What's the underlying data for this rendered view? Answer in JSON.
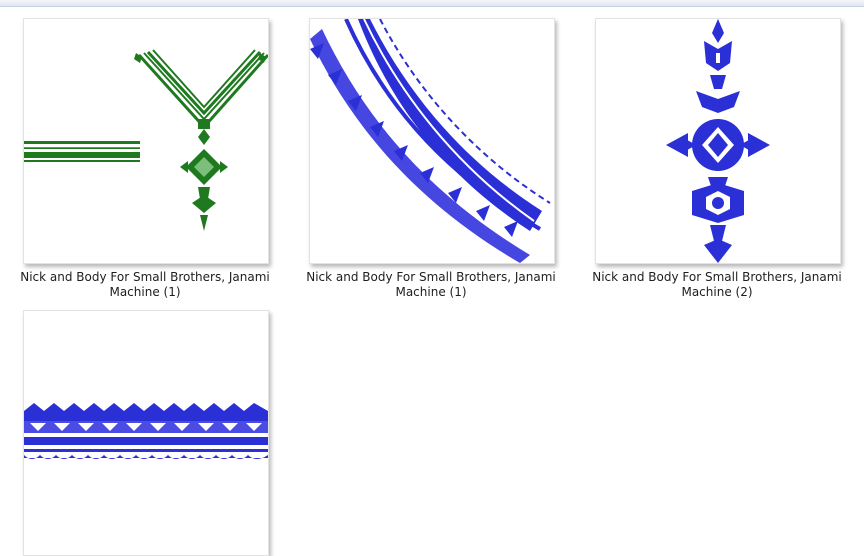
{
  "files": [
    {
      "name_line1": "Nick and Body For Small Brothers, Janami",
      "name_line2": "Machine (1)",
      "icon": "green-neckline-embroidery-thumbnail",
      "color": "#1f7a1f"
    },
    {
      "name_line1": "Nick and Body For Small Brothers, Janami",
      "name_line2": "Machine (1)",
      "icon": "blue-curved-border-embroidery-thumbnail",
      "color": "#2b2fd6"
    },
    {
      "name_line1": "Nick and Body For Small Brothers, Janami",
      "name_line2": "Machine (2)",
      "icon": "blue-motif-embroidery-thumbnail",
      "color": "#2b2fd6"
    },
    {
      "name_line1": "",
      "name_line2": "",
      "icon": "blue-straight-border-embroidery-thumbnail",
      "color": "#2b2fd6"
    }
  ]
}
